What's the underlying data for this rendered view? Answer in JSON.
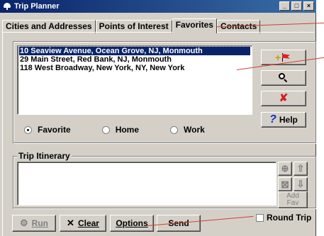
{
  "window": {
    "title": "Trip Planner",
    "controls": {
      "minimize": "_",
      "maximize": "□",
      "close": "×"
    }
  },
  "tabs": [
    {
      "label": "Cities and Addresses",
      "active": false
    },
    {
      "label": "Points of Interest",
      "active": false
    },
    {
      "label": "Favorites",
      "active": true
    },
    {
      "label": "Contacts",
      "active": false
    }
  ],
  "favorites": {
    "items": [
      "10 Seaview Avenue, Ocean Grove, NJ, Monmouth",
      "29 Main Street, Red Bank, NJ, Monmouth",
      "118 West Broadway, New York, NY, New York"
    ],
    "selected_index": 0,
    "radios": [
      {
        "label": "Favorite",
        "checked": true
      },
      {
        "label": "Home",
        "checked": false
      },
      {
        "label": "Work",
        "checked": false
      }
    ],
    "buttons": {
      "add_icon": "add-flag-icon",
      "zoom_icon": "magnifier-icon",
      "delete_icon": "red-x-icon",
      "help_label": "Help",
      "help_glyph": "?",
      "delete_glyph": "✘"
    }
  },
  "itinerary": {
    "label": "Trip Itinerary",
    "stops": [],
    "side_buttons": {
      "add_fav_line1": "Add",
      "add_fav_line2": "Fav"
    },
    "round_trip_label": "Round Trip",
    "round_trip_checked": false
  },
  "bottom_buttons": {
    "run": "Run",
    "clear": "Clear",
    "options": "Options",
    "send": "Send"
  },
  "colors": {
    "window_bg": "#d4d0c8",
    "title_start": "#0a246a",
    "title_end": "#3a6ea5",
    "selection": "#0a246a",
    "callout": "#d04030"
  }
}
